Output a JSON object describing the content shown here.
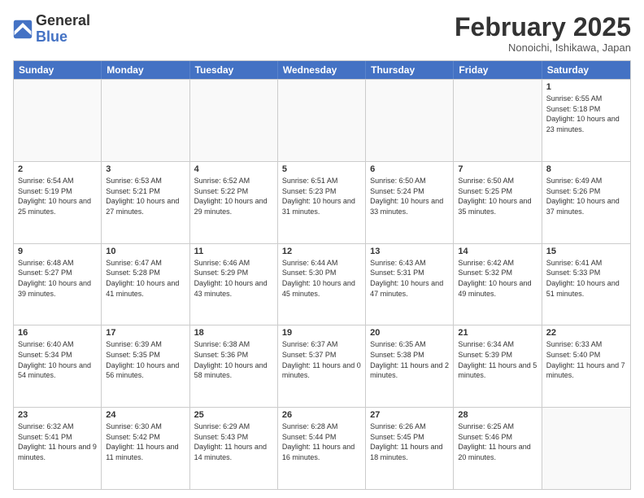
{
  "logo": {
    "general": "General",
    "blue": "Blue"
  },
  "header": {
    "month": "February 2025",
    "location": "Nonoichi, Ishikawa, Japan"
  },
  "days": [
    "Sunday",
    "Monday",
    "Tuesday",
    "Wednesday",
    "Thursday",
    "Friday",
    "Saturday"
  ],
  "weeks": [
    [
      {
        "date": "",
        "info": ""
      },
      {
        "date": "",
        "info": ""
      },
      {
        "date": "",
        "info": ""
      },
      {
        "date": "",
        "info": ""
      },
      {
        "date": "",
        "info": ""
      },
      {
        "date": "",
        "info": ""
      },
      {
        "date": "1",
        "info": "Sunrise: 6:55 AM\nSunset: 5:18 PM\nDaylight: 10 hours and 23 minutes."
      }
    ],
    [
      {
        "date": "2",
        "info": "Sunrise: 6:54 AM\nSunset: 5:19 PM\nDaylight: 10 hours and 25 minutes."
      },
      {
        "date": "3",
        "info": "Sunrise: 6:53 AM\nSunset: 5:21 PM\nDaylight: 10 hours and 27 minutes."
      },
      {
        "date": "4",
        "info": "Sunrise: 6:52 AM\nSunset: 5:22 PM\nDaylight: 10 hours and 29 minutes."
      },
      {
        "date": "5",
        "info": "Sunrise: 6:51 AM\nSunset: 5:23 PM\nDaylight: 10 hours and 31 minutes."
      },
      {
        "date": "6",
        "info": "Sunrise: 6:50 AM\nSunset: 5:24 PM\nDaylight: 10 hours and 33 minutes."
      },
      {
        "date": "7",
        "info": "Sunrise: 6:50 AM\nSunset: 5:25 PM\nDaylight: 10 hours and 35 minutes."
      },
      {
        "date": "8",
        "info": "Sunrise: 6:49 AM\nSunset: 5:26 PM\nDaylight: 10 hours and 37 minutes."
      }
    ],
    [
      {
        "date": "9",
        "info": "Sunrise: 6:48 AM\nSunset: 5:27 PM\nDaylight: 10 hours and 39 minutes."
      },
      {
        "date": "10",
        "info": "Sunrise: 6:47 AM\nSunset: 5:28 PM\nDaylight: 10 hours and 41 minutes."
      },
      {
        "date": "11",
        "info": "Sunrise: 6:46 AM\nSunset: 5:29 PM\nDaylight: 10 hours and 43 minutes."
      },
      {
        "date": "12",
        "info": "Sunrise: 6:44 AM\nSunset: 5:30 PM\nDaylight: 10 hours and 45 minutes."
      },
      {
        "date": "13",
        "info": "Sunrise: 6:43 AM\nSunset: 5:31 PM\nDaylight: 10 hours and 47 minutes."
      },
      {
        "date": "14",
        "info": "Sunrise: 6:42 AM\nSunset: 5:32 PM\nDaylight: 10 hours and 49 minutes."
      },
      {
        "date": "15",
        "info": "Sunrise: 6:41 AM\nSunset: 5:33 PM\nDaylight: 10 hours and 51 minutes."
      }
    ],
    [
      {
        "date": "16",
        "info": "Sunrise: 6:40 AM\nSunset: 5:34 PM\nDaylight: 10 hours and 54 minutes."
      },
      {
        "date": "17",
        "info": "Sunrise: 6:39 AM\nSunset: 5:35 PM\nDaylight: 10 hours and 56 minutes."
      },
      {
        "date": "18",
        "info": "Sunrise: 6:38 AM\nSunset: 5:36 PM\nDaylight: 10 hours and 58 minutes."
      },
      {
        "date": "19",
        "info": "Sunrise: 6:37 AM\nSunset: 5:37 PM\nDaylight: 11 hours and 0 minutes."
      },
      {
        "date": "20",
        "info": "Sunrise: 6:35 AM\nSunset: 5:38 PM\nDaylight: 11 hours and 2 minutes."
      },
      {
        "date": "21",
        "info": "Sunrise: 6:34 AM\nSunset: 5:39 PM\nDaylight: 11 hours and 5 minutes."
      },
      {
        "date": "22",
        "info": "Sunrise: 6:33 AM\nSunset: 5:40 PM\nDaylight: 11 hours and 7 minutes."
      }
    ],
    [
      {
        "date": "23",
        "info": "Sunrise: 6:32 AM\nSunset: 5:41 PM\nDaylight: 11 hours and 9 minutes."
      },
      {
        "date": "24",
        "info": "Sunrise: 6:30 AM\nSunset: 5:42 PM\nDaylight: 11 hours and 11 minutes."
      },
      {
        "date": "25",
        "info": "Sunrise: 6:29 AM\nSunset: 5:43 PM\nDaylight: 11 hours and 14 minutes."
      },
      {
        "date": "26",
        "info": "Sunrise: 6:28 AM\nSunset: 5:44 PM\nDaylight: 11 hours and 16 minutes."
      },
      {
        "date": "27",
        "info": "Sunrise: 6:26 AM\nSunset: 5:45 PM\nDaylight: 11 hours and 18 minutes."
      },
      {
        "date": "28",
        "info": "Sunrise: 6:25 AM\nSunset: 5:46 PM\nDaylight: 11 hours and 20 minutes."
      },
      {
        "date": "",
        "info": ""
      }
    ]
  ]
}
